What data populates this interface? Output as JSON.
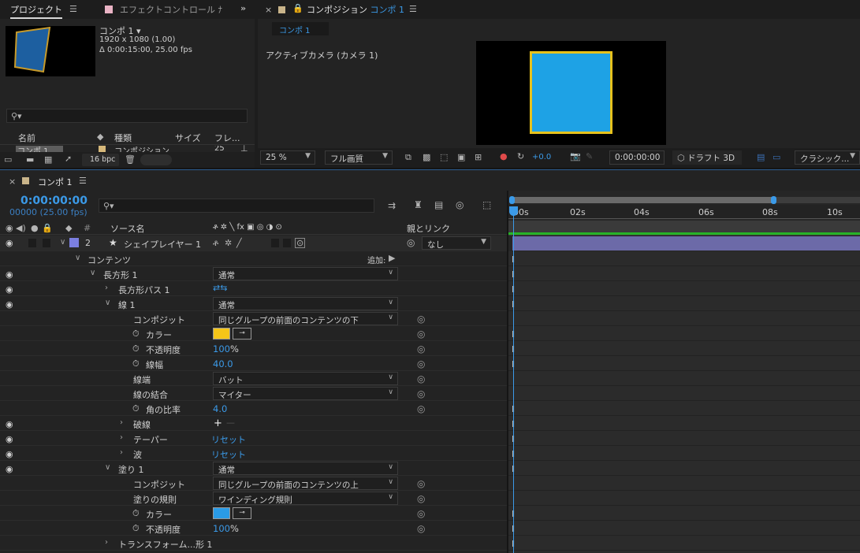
{
  "project": {
    "tab_label": "プロジェクト",
    "effects_tab_label": "エフェクトコントロール ﾅ",
    "item_name": "コンポ 1 ▾",
    "item_size": "1920 x 1080 (1.00)",
    "item_duration": "Δ 0:00:15:00, 25.00 fps",
    "search_placeholder": "",
    "columns": [
      "名前",
      "種類",
      "サイズ",
      "フレ..."
    ],
    "row": {
      "name": "コンポ 1",
      "type": "コンポジション",
      "frames": "25"
    },
    "bpc": "16 bpc"
  },
  "composition": {
    "tab_label": "コンポジション",
    "tab_name": "コンポ 1",
    "sub_tab": "コンポ 1",
    "camera_label": "アクティブカメラ (カメラ 1)",
    "zoom": "25 %",
    "quality": "フル画質",
    "exposure": "+0.0",
    "timecode": "0:00:00:00",
    "draft3d": "ドラフト 3D",
    "renderer": "クラシック..."
  },
  "timeline": {
    "tab_label": "コンポ 1",
    "timecode": "0:00:00:00",
    "frame_info": "00000 (25.00 fps)",
    "search_placeholder": "",
    "ruler": [
      "00s",
      "02s",
      "04s",
      "06s",
      "08s",
      "10s"
    ],
    "col_num": "#",
    "col_source": "ソース名",
    "col_switches": "ቶ ✲ ╲ fx ▣ ◎ ◑ ⊙",
    "col_parent": "親とリンク",
    "layer": {
      "number": "2",
      "name": "シェイプレイヤー 1",
      "parent": "なし"
    },
    "contents_label": "コンテンツ",
    "add_label": "追加:",
    "rect_group": {
      "label": "長方形 1",
      "mode": "通常"
    },
    "rect_path": "長方形パス 1",
    "stroke": {
      "label": "線 1",
      "mode": "通常"
    },
    "stroke_composite": {
      "label": "コンポジット",
      "value": "同じグループの前面のコンテンツの下"
    },
    "stroke_color": {
      "label": "カラー",
      "color": "#f5c518"
    },
    "stroke_opacity": {
      "label": "不透明度",
      "value": "100",
      "unit": "%"
    },
    "stroke_width": {
      "label": "線幅",
      "value": "40.0"
    },
    "line_cap": {
      "label": "線端",
      "value": "バット"
    },
    "line_join": {
      "label": "線の結合",
      "value": "マイター"
    },
    "miter_limit": {
      "label": "角の比率",
      "value": "4.0"
    },
    "dashes": {
      "label": "破線"
    },
    "taper": {
      "label": "テーパー",
      "value": "リセット"
    },
    "wave": {
      "label": "波",
      "value": "リセット"
    },
    "fill": {
      "label": "塗り 1",
      "mode": "通常"
    },
    "fill_composite": {
      "label": "コンポジット",
      "value": "同じグループの前面のコンテンツの上"
    },
    "fill_rule": {
      "label": "塗りの規則",
      "value": "ワインディング規則"
    },
    "fill_color": {
      "label": "カラー",
      "color": "#2a9be6"
    },
    "fill_opacity": {
      "label": "不透明度",
      "value": "100",
      "unit": "%"
    },
    "transform": {
      "label": "トランスフォーム...形 1"
    }
  },
  "colors": {
    "accent": "#3b9ae8",
    "layer_label": "#7b7fe0",
    "layer_bar": "#6c6aa8",
    "stroke": "#f5c518",
    "fill": "#2a9be6"
  }
}
